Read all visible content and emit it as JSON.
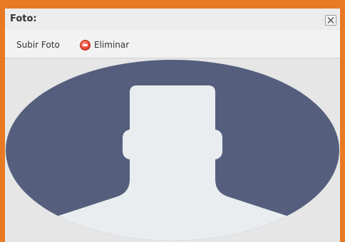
{
  "dialog": {
    "title": "Foto:",
    "close_icon": "close-icon"
  },
  "toolbar": {
    "upload_label": "Subir Foto",
    "delete_label": "Eliminar",
    "delete_icon": "delete-icon"
  },
  "photo": {
    "placeholder_icon": "user-silhouette-icon"
  },
  "colors": {
    "frame": "#e87a23",
    "avatar_background": "#555f7d",
    "silhouette": "#e9edf0",
    "photo_area": "#e6e6e6"
  }
}
